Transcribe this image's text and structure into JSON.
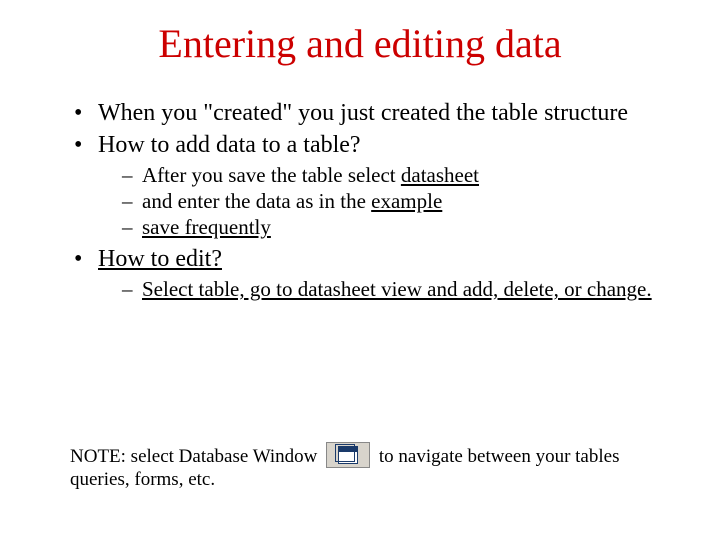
{
  "title": "Entering and editing data",
  "bullets": {
    "b1": "When you \"created\"  you just created the table structure",
    "b2": "How to add data to a table?",
    "b2sub": {
      "s1a": "After you save the table select ",
      "s1b": "datasheet",
      "s2a": "and enter the data as in the ",
      "s2b": "example",
      "s3": "save frequently"
    },
    "b3": "How to edit?",
    "b3sub": {
      "s1": "Select table, go to datasheet view and add, delete, or change."
    }
  },
  "note": {
    "prefix": "NOTE: select Database Window ",
    "suffix": " to navigate between your tables queries, forms, etc."
  }
}
